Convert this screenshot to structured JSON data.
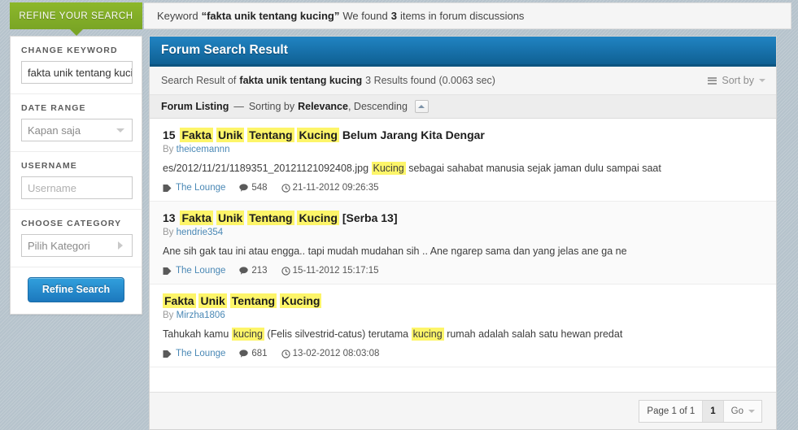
{
  "top": {
    "refine_tab_label": "REFINE YOUR SEARCH",
    "keyword_prefix": "Keyword",
    "keyword_quoted": "“fakta unik tentang kucing”",
    "keyword_middle": "We found",
    "keyword_count": "3",
    "keyword_suffix": "items in forum discussions"
  },
  "sidebar": {
    "groups": [
      {
        "label": "CHANGE KEYWORD",
        "value": "fakta unik tentang kuci",
        "placeholder": "",
        "control": "text"
      },
      {
        "label": "DATE RANGE",
        "value": "Kapan saja",
        "placeholder": "",
        "control": "select-down"
      },
      {
        "label": "USERNAME",
        "value": "",
        "placeholder": "Username",
        "control": "text"
      },
      {
        "label": "CHOOSE CATEGORY",
        "value": "Pilih Kategori",
        "placeholder": "",
        "control": "select-right"
      }
    ],
    "submit_label": "Refine Search"
  },
  "panel": {
    "title": "Forum Search Result",
    "summary_prefix": "Search Result of",
    "summary_keyword": "fakta unik tentang kucing",
    "summary_suffix": "3 Results found (0.0063 sec)",
    "sort_by_label": "Sort by",
    "listing_title": "Forum Listing",
    "listing_dash": "—",
    "listing_sorting_prefix": "Sorting by",
    "listing_sort_field": "Relevance",
    "listing_sort_direction": ", Descending"
  },
  "results": [
    {
      "number": "15",
      "title_parts": [
        {
          "text": "Fakta",
          "hl": true
        },
        {
          "text": "Unik",
          "hl": true
        },
        {
          "text": "Tentang",
          "hl": true
        },
        {
          "text": "Kucing",
          "hl": true
        },
        {
          "text": "Belum Jarang Kita Dengar",
          "hl": false
        }
      ],
      "by_label": "By",
      "author": "theicemannn",
      "snippet_parts": [
        {
          "text": "es/2012/11/21/1189351_20121121092408.jpg",
          "hl": false
        },
        {
          "text": "Kucing",
          "hl": true
        },
        {
          "text": "sebagai sahabat manusia sejak jaman dulu sampai saat",
          "hl": false
        }
      ],
      "forum": "The Lounge",
      "replies": "548",
      "date": "21-11-2012 09:26:35"
    },
    {
      "number": "13",
      "title_parts": [
        {
          "text": "Fakta",
          "hl": true
        },
        {
          "text": "Unik",
          "hl": true
        },
        {
          "text": "Tentang",
          "hl": true
        },
        {
          "text": "Kucing",
          "hl": true
        },
        {
          "text": "[Serba 13]",
          "hl": false
        }
      ],
      "by_label": "By",
      "author": "hendrie354",
      "snippet_parts": [
        {
          "text": "Ane sih gak tau ini atau engga.. tapi mudah mudahan sih .. Ane ngarep sama dan yang jelas ane ga ne",
          "hl": false
        }
      ],
      "forum": "The Lounge",
      "replies": "213",
      "date": "15-11-2012 15:17:15"
    },
    {
      "number": "",
      "title_parts": [
        {
          "text": "Fakta",
          "hl": true
        },
        {
          "text": "Unik",
          "hl": true
        },
        {
          "text": "Tentang",
          "hl": true
        },
        {
          "text": "Kucing",
          "hl": true
        }
      ],
      "by_label": "By",
      "author": "Mirzha1806",
      "snippet_parts": [
        {
          "text": "Tahukah kamu",
          "hl": false
        },
        {
          "text": "kucing",
          "hl": true
        },
        {
          "text": "(Felis silvestrid-catus) terutama",
          "hl": false
        },
        {
          "text": "kucing",
          "hl": true
        },
        {
          "text": "rumah adalah salah satu hewan predat",
          "hl": false
        }
      ],
      "forum": "The Lounge",
      "replies": "681",
      "date": "13-02-2012 08:03:08"
    }
  ],
  "pagination": {
    "page_label": "Page 1 of 1",
    "current_page": "1",
    "go_label": "Go"
  },
  "colors": {
    "accent_green": "#8cb72b",
    "accent_blue": "#1c78bd",
    "panel_header_blue": "#2184c3",
    "highlight_yellow": "#fdf569",
    "link_blue": "#4a88b5",
    "page_bg": "#b6c3cc"
  }
}
